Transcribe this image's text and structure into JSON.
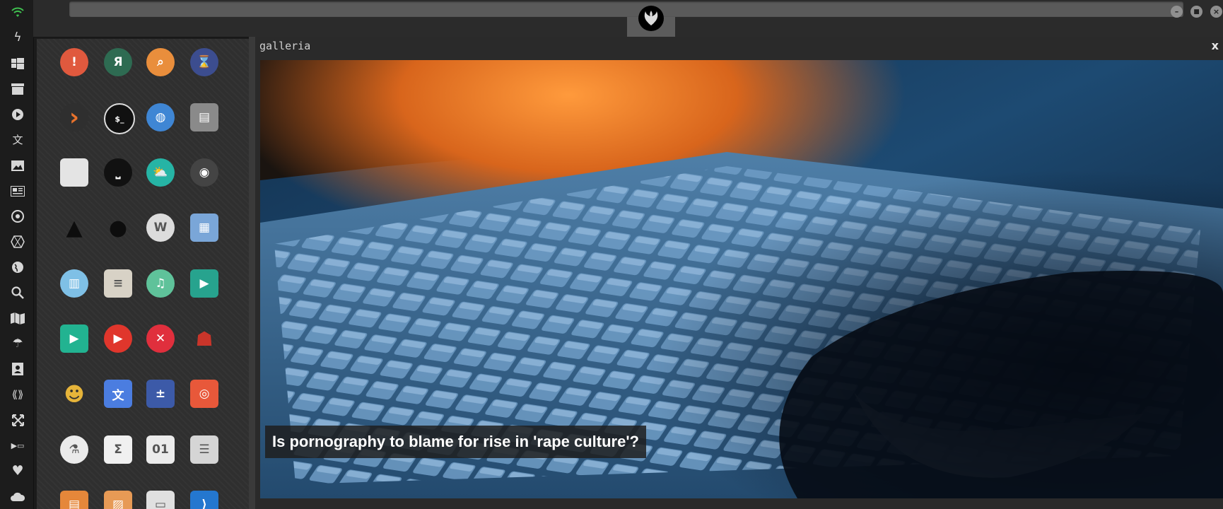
{
  "window": {
    "title": "galleria",
    "close_label": "x"
  },
  "window_controls": {
    "minimize": "–",
    "maximize": "■",
    "close": "×"
  },
  "sidebar": {
    "icons": [
      "wifi-icon",
      "lightning-icon",
      "windows-icon",
      "archive-icon",
      "play-icon",
      "translate-icon",
      "image-icon",
      "newspaper-icon",
      "rebel-icon",
      "hexagon-icon",
      "globe-icon",
      "search-icon",
      "map-icon",
      "umbrella-icon",
      "contact-icon",
      "link-icon",
      "expand-icon",
      "youtube-icon",
      "heart-icon",
      "cloud-icon"
    ]
  },
  "launcher": {
    "apps": [
      {
        "name": "warning-icon",
        "glyph": "!",
        "color": "#e0593e"
      },
      {
        "name": "yandex-browser-icon",
        "glyph": "Я",
        "color": "#2e6b52"
      },
      {
        "name": "search-app-icon",
        "glyph": "⌕",
        "color": "#e98e3c"
      },
      {
        "name": "hourglass-icon",
        "glyph": "⌛",
        "color": "#3c4d8f"
      },
      {
        "name": "prompt-arrow-icon",
        "glyph": "›",
        "color": "#2f2f2f"
      },
      {
        "name": "terminal-icon",
        "glyph": "$_",
        "color": "#111111"
      },
      {
        "name": "globe-app-icon",
        "glyph": "◍",
        "color": "#3f86d4"
      },
      {
        "name": "disk-drive-icon",
        "glyph": "▤",
        "color": "#8a8a8a"
      },
      {
        "name": "browser-window-icon",
        "glyph": "",
        "color": "#e4e4e4"
      },
      {
        "name": "keyboard-app-icon",
        "glyph": "⎵",
        "color": "#111111"
      },
      {
        "name": "cloud-lock-icon",
        "glyph": "⛅",
        "color": "#26b4a5"
      },
      {
        "name": "github-icon",
        "glyph": "◉",
        "color": "#444444"
      },
      {
        "name": "starfleet-icon",
        "glyph": "▲",
        "color": "#2f2f2f"
      },
      {
        "name": "death-star-icon",
        "glyph": "●",
        "color": "#111111"
      },
      {
        "name": "wikipedia-icon",
        "glyph": "W",
        "color": "#dcdcdc"
      },
      {
        "name": "world-map-icon",
        "glyph": "▦",
        "color": "#7aa6d8"
      },
      {
        "name": "library-icon",
        "glyph": "▥",
        "color": "#7fc0e6"
      },
      {
        "name": "document-viewer-icon",
        "glyph": "≡",
        "color": "#d8d2c6"
      },
      {
        "name": "music-icon",
        "glyph": "♫",
        "color": "#5fc29a"
      },
      {
        "name": "video-player-icon",
        "glyph": "▶",
        "color": "#27a38e"
      },
      {
        "name": "media-play-icon",
        "glyph": "▶",
        "color": "#22b391"
      },
      {
        "name": "youtube-app-icon",
        "glyph": "▶",
        "color": "#e0362c"
      },
      {
        "name": "close-app-icon",
        "glyph": "✕",
        "color": "#e02f3d"
      },
      {
        "name": "iron-man-icon",
        "glyph": "☗",
        "color": "#2f2f2f"
      },
      {
        "name": "c3po-icon",
        "glyph": "☻",
        "color": "#2f2f2f"
      },
      {
        "name": "translator-icon",
        "glyph": "文",
        "color": "#4b7de0"
      },
      {
        "name": "calculator-icon",
        "glyph": "±",
        "color": "#3c5aa8"
      },
      {
        "name": "photo-booth-icon",
        "glyph": "◎",
        "color": "#e8583a"
      },
      {
        "name": "chemistry-icon",
        "glyph": "⚗",
        "color": "#ebebeb"
      },
      {
        "name": "math-sigma-icon",
        "glyph": "Σ",
        "color": "#f0f0f0"
      },
      {
        "name": "binary-file-icon",
        "glyph": "01",
        "color": "#ebebeb"
      },
      {
        "name": "text-editor-icon",
        "glyph": "☰",
        "color": "#d5d5d5"
      },
      {
        "name": "document-app-icon",
        "glyph": "▤",
        "color": "#e5873a"
      },
      {
        "name": "image-viewer-icon",
        "glyph": "▨",
        "color": "#e79a55"
      },
      {
        "name": "presentation-icon",
        "glyph": "▭",
        "color": "#e0e0e0"
      },
      {
        "name": "vscode-icon",
        "glyph": "⟩",
        "color": "#2477cf"
      }
    ]
  },
  "gallery": {
    "caption": "Is pornography to blame for rise in 'rape culture'?"
  }
}
